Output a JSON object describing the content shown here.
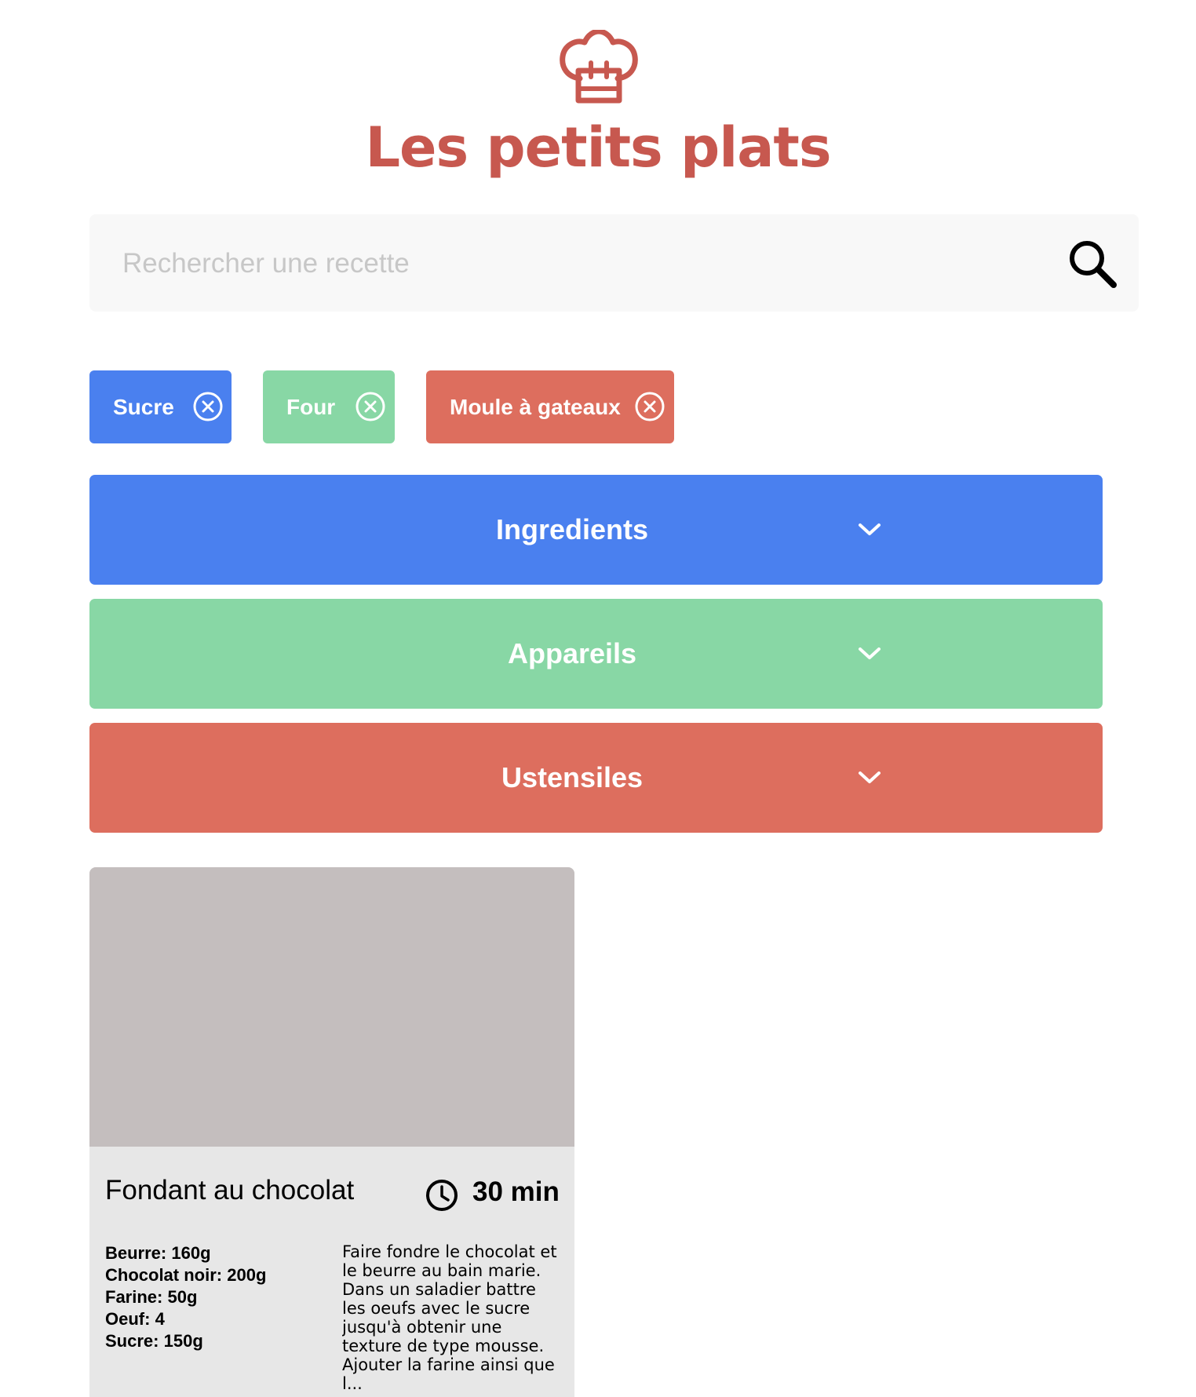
{
  "header": {
    "logo_icon": "chef-hat-icon",
    "title": "Les petits plats",
    "brand_color": "#C7584F"
  },
  "search": {
    "placeholder": "Rechercher une recette",
    "value": "",
    "icon": "search-icon"
  },
  "tags": [
    {
      "label": "Sucre",
      "color": "#4A80EF",
      "icon": "close-circle-icon"
    },
    {
      "label": "Four",
      "color": "#88D7A5",
      "icon": "close-circle-icon"
    },
    {
      "label": "Moule à gateaux",
      "color": "#DD6E5E",
      "icon": "close-circle-icon"
    }
  ],
  "filters": [
    {
      "label": "Ingredients",
      "color": "#4A80EF",
      "icon": "chevron-down-icon"
    },
    {
      "label": "Appareils",
      "color": "#88D7A5",
      "icon": "chevron-down-icon"
    },
    {
      "label": "Ustensiles",
      "color": "#DD6E5E",
      "icon": "chevron-down-icon"
    }
  ],
  "recipes": [
    {
      "title": "Fondant au chocolat",
      "time": "30 min",
      "time_icon": "clock-icon",
      "ingredients": [
        {
          "name": "Beurre",
          "quantity": "160g"
        },
        {
          "name": "Chocolat noir",
          "quantity": "200g"
        },
        {
          "name": "Farine",
          "quantity": "50g"
        },
        {
          "name": "Oeuf",
          "quantity": "4"
        },
        {
          "name": "Sucre",
          "quantity": "150g"
        }
      ],
      "description": "Faire fondre le chocolat et le beurre au bain marie. Dans un saladier battre les oeufs avec le sucre jusqu'à obtenir une texture de type mousse. Ajouter la farine ainsi que l..."
    }
  ]
}
